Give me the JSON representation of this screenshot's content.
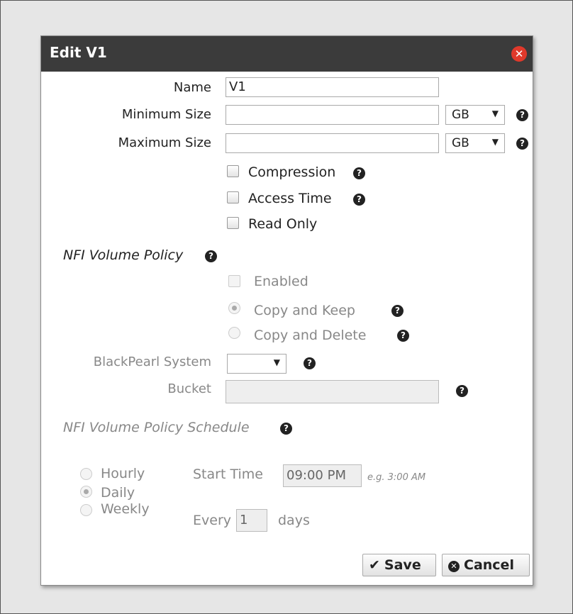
{
  "dialog": {
    "title": "Edit V1",
    "close_icon": "close-icon"
  },
  "form": {
    "name_label": "Name",
    "name_value": "V1",
    "min_size_label": "Minimum Size",
    "min_size_value": "",
    "min_unit": "GB",
    "max_size_label": "Maximum Size",
    "max_size_value": "",
    "max_unit": "GB",
    "compression_label": "Compression",
    "access_time_label": "Access Time",
    "read_only_label": "Read Only"
  },
  "nfi_policy": {
    "heading": "NFI Volume Policy",
    "enabled_label": "Enabled",
    "copy_keep_label": "Copy and Keep",
    "copy_delete_label": "Copy and Delete",
    "blackpearl_label": "BlackPearl System",
    "blackpearl_value": "",
    "bucket_label": "Bucket",
    "bucket_value": ""
  },
  "schedule": {
    "heading": "NFI Volume Policy Schedule",
    "hourly_label": "Hourly",
    "daily_label": "Daily",
    "weekly_label": "Weekly",
    "start_time_label": "Start Time",
    "start_time_value": "09:00 PM",
    "start_time_hint": "e.g. 3:00 AM",
    "every_label": "Every",
    "every_value": "1",
    "days_label": "days"
  },
  "buttons": {
    "save_label": "Save",
    "cancel_label": "Cancel"
  },
  "colors": {
    "titlebar": "#3b3b3b",
    "close": "#e0392b",
    "disabled_text": "#888888"
  }
}
